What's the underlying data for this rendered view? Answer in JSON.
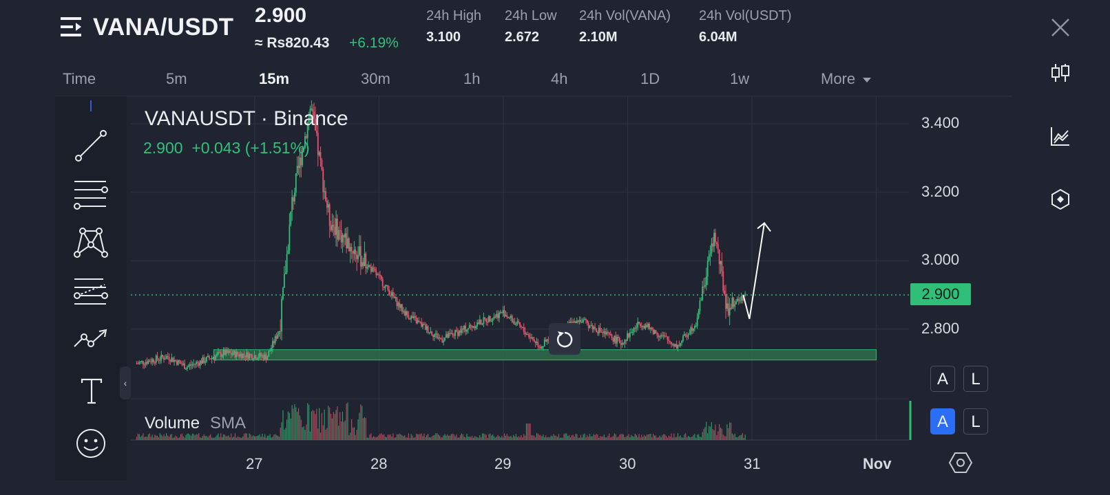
{
  "header": {
    "pair": "VANA/USDT",
    "price": "2.900",
    "fiat_price": "≈ Rs820.43",
    "change_pct": "+6.19%",
    "stats": [
      {
        "label": "24h High",
        "value": "3.100"
      },
      {
        "label": "24h Low",
        "value": "2.672"
      },
      {
        "label": "24h Vol(VANA)",
        "value": "2.10M"
      },
      {
        "label": "24h Vol(USDT)",
        "value": "6.04M"
      }
    ]
  },
  "intervals": {
    "time": "Time",
    "items": [
      "5m",
      "15m",
      "30m",
      "1h",
      "4h",
      "1D",
      "1w"
    ],
    "active": "15m",
    "more": "More"
  },
  "chart": {
    "ticker": "VANAUSDT · Binance",
    "last": "2.900",
    "change": "+0.043 (+1.51%)",
    "volume_label": "Volume",
    "volume_indicator": "SMA",
    "y_ticks": [
      "3.400",
      "3.200",
      "3.000",
      "2.800"
    ],
    "current_price_tag": "2.900",
    "x_ticks": [
      "27",
      "28",
      "29",
      "30",
      "31",
      "Nov"
    ],
    "scale_buttons": [
      {
        "label": "A",
        "active": false
      },
      {
        "label": "L",
        "active": false
      },
      {
        "label": "A",
        "active": true
      },
      {
        "label": "L",
        "active": false
      }
    ]
  },
  "chart_data": {
    "type": "candlestick",
    "symbol": "VANAUSDT",
    "exchange": "Binance",
    "interval": "15m",
    "ylim": [
      2.65,
      3.5
    ],
    "x_range": [
      "26",
      "Nov"
    ],
    "close_path": [
      {
        "day": 26.05,
        "price": 2.7
      },
      {
        "day": 26.3,
        "price": 2.72
      },
      {
        "day": 26.45,
        "price": 2.69
      },
      {
        "day": 26.75,
        "price": 2.73
      },
      {
        "day": 27.1,
        "price": 2.72
      },
      {
        "day": 27.2,
        "price": 2.8
      },
      {
        "day": 27.3,
        "price": 3.17
      },
      {
        "day": 27.45,
        "price": 3.45
      },
      {
        "day": 27.6,
        "price": 3.12
      },
      {
        "day": 27.75,
        "price": 3.05
      },
      {
        "day": 28.0,
        "price": 2.95
      },
      {
        "day": 28.2,
        "price": 2.85
      },
      {
        "day": 28.5,
        "price": 2.77
      },
      {
        "day": 29.0,
        "price": 2.85
      },
      {
        "day": 29.3,
        "price": 2.75
      },
      {
        "day": 29.6,
        "price": 2.83
      },
      {
        "day": 29.95,
        "price": 2.76
      },
      {
        "day": 30.1,
        "price": 2.82
      },
      {
        "day": 30.4,
        "price": 2.75
      },
      {
        "day": 30.55,
        "price": 2.82
      },
      {
        "day": 30.7,
        "price": 3.08
      },
      {
        "day": 30.8,
        "price": 2.86
      },
      {
        "day": 30.95,
        "price": 2.9
      }
    ],
    "support_zone": [
      2.71,
      2.74
    ],
    "projection_arrow": {
      "from": 2.83,
      "to": 3.11
    },
    "last_price": 2.9,
    "grid": true
  }
}
